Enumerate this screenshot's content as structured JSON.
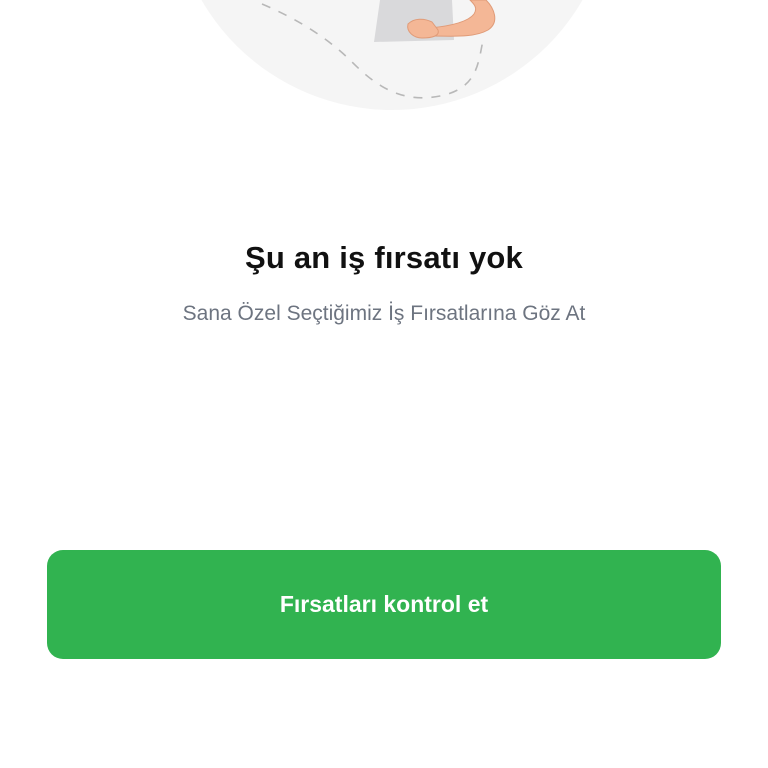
{
  "illustration": {
    "icon": "person-with-document-illustration"
  },
  "empty_state": {
    "title": "Şu an iş fırsatı yok",
    "subtitle": "Sana Özel Seçtiğimiz İş Fırsatlarına Göz At"
  },
  "cta": {
    "label": "Fırsatları kontrol et"
  },
  "colors": {
    "accent": "#31b350",
    "title": "#111111",
    "subtitle": "#6d7480",
    "illustration_bg": "#f5f5f5",
    "skin": "#f4b796"
  }
}
